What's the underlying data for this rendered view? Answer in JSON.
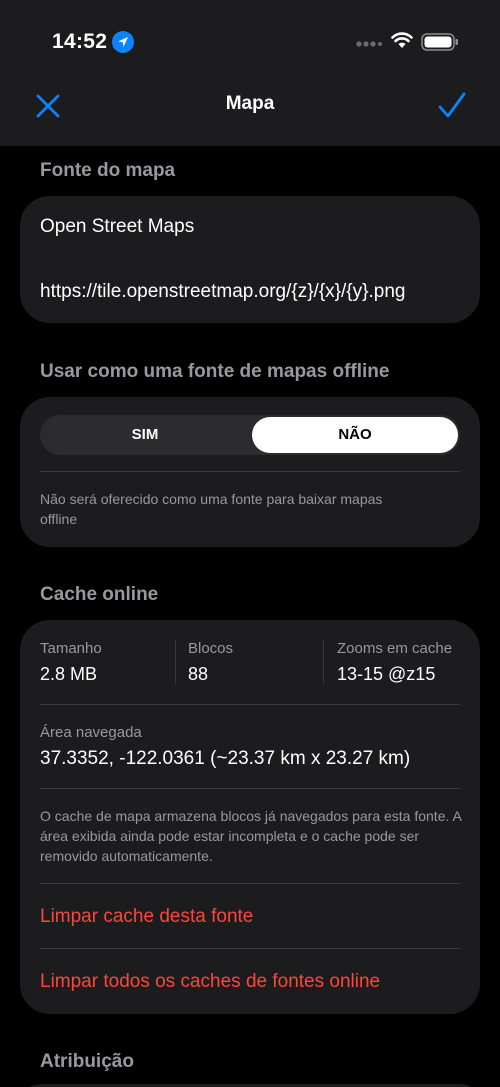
{
  "status_bar": {
    "time": "14:52"
  },
  "nav": {
    "title": "Mapa"
  },
  "map_source": {
    "header": "Fonte do mapa",
    "name": "Open Street Maps",
    "url": "https://tile.openstreetmap.org/{z}/{x}/{y}.png"
  },
  "offline": {
    "header": "Usar como uma fonte de mapas offline",
    "options": [
      "SIM",
      "NÃO"
    ],
    "selected": "NÃO",
    "note": "Não será oferecido como uma fonte para baixar mapas offline"
  },
  "cache": {
    "header": "Cache online",
    "size_label": "Tamanho",
    "size_value": "2.8 MB",
    "blocks_label": "Blocos",
    "blocks_value": "88",
    "zooms_label": "Zooms em cache",
    "zooms_value": "13-15 @z15",
    "area_label": "Área navegada",
    "area_value": "37.3352, -122.0361  (~23.37 km x 23.27 km)",
    "note": "O cache de mapa armazena blocos já navegados para esta fonte. A área exibida ainda pode estar incompleta e o cache pode ser removido automaticamente.",
    "clear_this": "Limpar cache desta fonte",
    "clear_all": "Limpar todos os caches de fontes online"
  },
  "attribution": {
    "header": "Atribuição"
  },
  "colors": {
    "accent": "#0a84ff",
    "destructive": "#ff453a",
    "card": "#1c1c1e",
    "secondary_text": "#98989f"
  }
}
